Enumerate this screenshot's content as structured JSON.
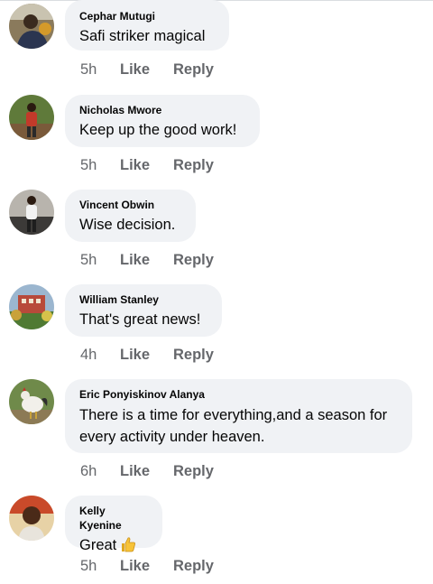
{
  "comments": [
    {
      "author": "Cephar Mutugi",
      "text": "Safi striker magical",
      "time": "5h",
      "like_label": "Like",
      "reply_label": "Reply",
      "avatar_icon": "person-avatar-icon"
    },
    {
      "author": "Nicholas Mwore",
      "text": "Keep up the good work!",
      "time": "5h",
      "like_label": "Like",
      "reply_label": "Reply",
      "avatar_icon": "person-avatar-icon"
    },
    {
      "author": "Vincent Obwin",
      "text": "Wise decision.",
      "time": "5h",
      "like_label": "Like",
      "reply_label": "Reply",
      "avatar_icon": "person-avatar-icon"
    },
    {
      "author": "William Stanley",
      "text": "That's great news!",
      "time": "4h",
      "like_label": "Like",
      "reply_label": "Reply",
      "avatar_icon": "building-avatar-icon"
    },
    {
      "author": "Eric Ponyiskinov Alanya",
      "text": "There is a time for everything,and a season for every activity under heaven.",
      "time": "6h",
      "like_label": "Like",
      "reply_label": "Reply",
      "avatar_icon": "rooster-avatar-icon"
    },
    {
      "author": "Kelly Kyenine",
      "text": "Great",
      "time": "5h",
      "like_label": "Like",
      "reply_label": "Reply",
      "avatar_icon": "person-avatar-icon",
      "emoji_icon": "thumbs-up-icon"
    }
  ],
  "colors": {
    "bubble_bg": "#f0f2f5",
    "meta_text": "#65676b",
    "primary_text": "#050505"
  }
}
